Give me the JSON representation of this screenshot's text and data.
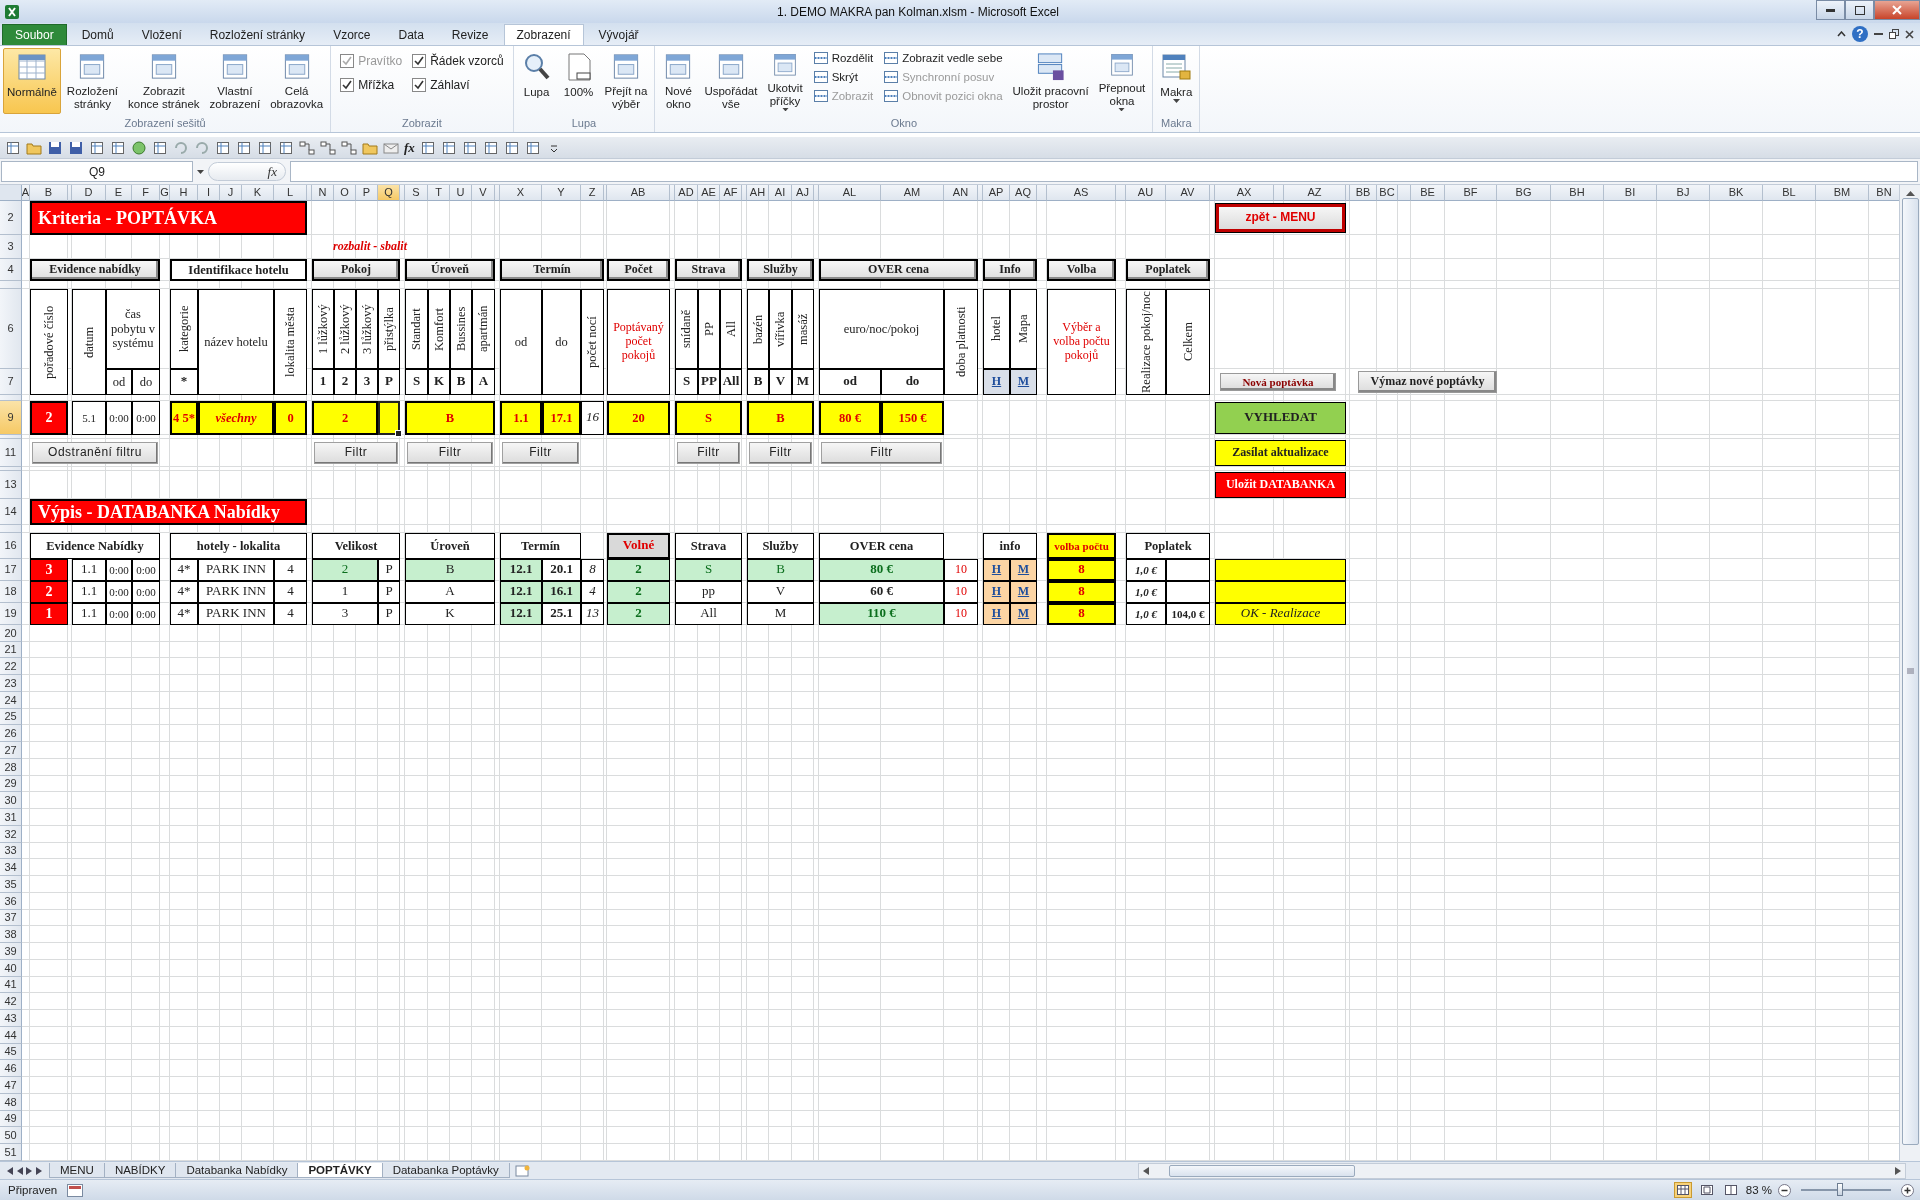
{
  "window": {
    "title": "1. DEMO MAKRA pan Kolman.xlsm  -  Microsoft Excel",
    "help": "?"
  },
  "ribbon_tabs": [
    {
      "label": "Soubor",
      "kind": "file",
      "selected": false
    },
    {
      "label": "Domů",
      "kind": "tab",
      "selected": false
    },
    {
      "label": "Vložení",
      "kind": "tab",
      "selected": false
    },
    {
      "label": "Rozložení stránky",
      "kind": "tab",
      "selected": false
    },
    {
      "label": "Vzorce",
      "kind": "tab",
      "selected": false
    },
    {
      "label": "Data",
      "kind": "tab",
      "selected": false
    },
    {
      "label": "Revize",
      "kind": "tab",
      "selected": false
    },
    {
      "label": "Zobrazení",
      "kind": "tab",
      "selected": true
    },
    {
      "label": "Vývojář",
      "kind": "tab",
      "selected": false
    }
  ],
  "ribbon_groups": [
    {
      "label": "Zobrazení sešitů",
      "items": [
        {
          "kind": "view",
          "label": "Normálně",
          "selected": true,
          "dropdown": false
        },
        {
          "kind": "view",
          "label": "Rozložení\nstránky",
          "selected": false,
          "dropdown": false
        },
        {
          "kind": "view",
          "label": "Zobrazit\nkonce stránek",
          "selected": false,
          "dropdown": false
        },
        {
          "kind": "large",
          "label": "Vlastní\nzobrazení",
          "dropdown": false
        },
        {
          "kind": "large",
          "label": "Celá\nobrazovka",
          "dropdown": false
        }
      ]
    },
    {
      "label": "Zobrazit",
      "items": [
        {
          "kind": "check",
          "label": "Pravítko",
          "checked": true,
          "disabled": true
        },
        {
          "kind": "check",
          "label": "Řádek vzorců",
          "checked": true,
          "disabled": false
        },
        {
          "kind": "check",
          "label": "Mřížka",
          "checked": true,
          "disabled": false
        },
        {
          "kind": "check",
          "label": "Záhlaví",
          "checked": true,
          "disabled": false
        }
      ]
    },
    {
      "label": "Lupa",
      "items": [
        {
          "kind": "large",
          "label": "Lupa",
          "dropdown": false
        },
        {
          "kind": "large",
          "label": "100%",
          "dropdown": false
        },
        {
          "kind": "large",
          "label": "Přejít na\nvýběr",
          "dropdown": false
        }
      ]
    },
    {
      "label": "Okno",
      "items": [
        {
          "kind": "large",
          "label": "Nové\nokno",
          "dropdown": false
        },
        {
          "kind": "large",
          "label": "Uspořádat\nvše",
          "dropdown": false
        },
        {
          "kind": "large",
          "label": "Ukotvit\npříčky",
          "dropdown": true
        },
        {
          "kind": "small",
          "label": "Rozdělit",
          "disabled": false
        },
        {
          "kind": "small",
          "label": "Skrýt",
          "disabled": false
        },
        {
          "kind": "small",
          "label": "Zobrazit",
          "disabled": true
        },
        {
          "kind": "small",
          "label": "Zobrazit vedle sebe",
          "disabled": false
        },
        {
          "kind": "small",
          "label": "Synchronní posuv",
          "disabled": true
        },
        {
          "kind": "small",
          "label": "Obnovit pozici okna",
          "disabled": true
        },
        {
          "kind": "large",
          "label": "Uložit pracovní\nprostor",
          "dropdown": false
        },
        {
          "kind": "large",
          "label": "Přepnout\nokna",
          "dropdown": true
        }
      ]
    },
    {
      "label": "Makra",
      "items": [
        {
          "kind": "large",
          "label": "Makra",
          "dropdown": true
        }
      ]
    }
  ],
  "quick_access": {
    "function_label": "fx"
  },
  "formula_bar": {
    "name_box": "Q9",
    "function_label": "fx"
  },
  "column_headers": [
    {
      "label": "A",
      "selected": false
    },
    {
      "label": "B",
      "selected": false
    },
    {
      "selected": false
    },
    {
      "label": "D",
      "selected": false
    },
    {
      "label": "E",
      "selected": false
    },
    {
      "label": "F",
      "selected": false
    },
    {
      "label": "G",
      "selected": false
    },
    {
      "label": "H",
      "selected": false
    },
    {
      "label": "I",
      "selected": false
    },
    {
      "label": "J",
      "selected": false
    },
    {
      "label": "K",
      "selected": false
    },
    {
      "label": "L",
      "selected": false
    },
    {
      "selected": false
    },
    {
      "label": "N",
      "selected": false
    },
    {
      "label": "O",
      "selected": false
    },
    {
      "label": "P",
      "selected": false
    },
    {
      "label": "Q",
      "selected": true
    },
    {
      "selected": false
    },
    {
      "label": "S",
      "selected": false
    },
    {
      "label": "T",
      "selected": false
    },
    {
      "label": "U",
      "selected": false
    },
    {
      "label": "V",
      "selected": false
    },
    {
      "selected": false
    },
    {
      "label": "X",
      "selected": false
    },
    {
      "label": "Y",
      "selected": false
    },
    {
      "label": "Z",
      "selected": false
    },
    {
      "selected": false
    },
    {
      "label": "AB",
      "selected": false
    },
    {
      "selected": false
    },
    {
      "label": "AD",
      "selected": false
    },
    {
      "label": "AE",
      "selected": false
    },
    {
      "label": "AF",
      "selected": false
    },
    {
      "selected": false
    },
    {
      "label": "AH",
      "selected": false
    },
    {
      "label": "AI",
      "selected": false
    },
    {
      "label": "AJ",
      "selected": false
    },
    {
      "selected": false
    },
    {
      "label": "AL",
      "selected": false
    },
    {
      "label": "AM",
      "selected": false
    },
    {
      "label": "AN",
      "selected": false
    },
    {
      "selected": false
    },
    {
      "label": "AP",
      "selected": false
    },
    {
      "label": "AQ",
      "selected": false
    },
    {
      "selected": false
    },
    {
      "label": "AS",
      "selected": false
    },
    {
      "selected": false
    },
    {
      "label": "AU",
      "selected": false
    },
    {
      "label": "AV",
      "selected": false
    },
    {
      "selected": false
    },
    {
      "label": "AX",
      "selected": false
    },
    {
      "selected": false
    },
    {
      "label": "AZ",
      "selected": false
    },
    {
      "selected": false
    },
    {
      "label": "BB",
      "selected": false
    },
    {
      "label": "BC",
      "selected": false
    },
    {
      "selected": false
    },
    {
      "label": "BE",
      "selected": false
    },
    {
      "label": "BF",
      "selected": false
    },
    {
      "label": "BG",
      "selected": false
    },
    {
      "label": "BH",
      "selected": false
    },
    {
      "label": "BI",
      "selected": false
    },
    {
      "label": "BJ",
      "selected": false
    },
    {
      "label": "BK",
      "selected": false
    },
    {
      "label": "BL",
      "selected": false
    },
    {
      "label": "BM",
      "selected": false
    },
    {
      "label": "BN",
      "selected": false
    }
  ],
  "row_headers": [
    {
      "label": "2",
      "selected": false
    },
    {
      "label": "3",
      "selected": false
    },
    {
      "label": "4",
      "selected": false
    },
    {
      "selected": false
    },
    {
      "label": "6",
      "selected": false
    },
    {
      "label": "7",
      "selected": false
    },
    {
      "selected": false
    },
    {
      "label": "9",
      "selected": true
    },
    {
      "selected": false
    },
    {
      "label": "11",
      "selected": false
    },
    {
      "selected": false
    },
    {
      "label": "13",
      "selected": false
    },
    {
      "label": "14",
      "selected": false
    },
    {
      "selected": false
    },
    {
      "label": "16",
      "selected": false
    },
    {
      "label": "17",
      "selected": false
    },
    {
      "label": "18",
      "selected": false
    },
    {
      "label": "19",
      "selected": false
    },
    {
      "label": "20",
      "selected": false
    },
    {
      "label": "21",
      "selected": false
    },
    {
      "label": "22",
      "selected": false
    },
    {
      "label": "23",
      "selected": false
    },
    {
      "label": "24",
      "selected": false
    },
    {
      "label": "25",
      "selected": false
    },
    {
      "label": "26",
      "selected": false
    },
    {
      "label": "27",
      "selected": false
    },
    {
      "label": "28",
      "selected": false
    },
    {
      "label": "29",
      "selected": false
    },
    {
      "label": "30",
      "selected": false
    },
    {
      "label": "31",
      "selected": false
    },
    {
      "label": "32",
      "selected": false
    },
    {
      "label": "33",
      "selected": false
    },
    {
      "label": "34",
      "selected": false
    },
    {
      "label": "35",
      "selected": false
    },
    {
      "label": "36",
      "selected": false
    },
    {
      "label": "37",
      "selected": false
    },
    {
      "label": "38",
      "selected": false
    },
    {
      "label": "39",
      "selected": false
    },
    {
      "label": "40",
      "selected": false
    },
    {
      "label": "41",
      "selected": false
    },
    {
      "label": "42",
      "selected": false
    },
    {
      "label": "43",
      "selected": false
    },
    {
      "label": "44",
      "selected": false
    },
    {
      "label": "45",
      "selected": false
    },
    {
      "label": "46",
      "selected": false
    },
    {
      "label": "47",
      "selected": false
    },
    {
      "label": "48",
      "selected": false
    },
    {
      "label": "49",
      "selected": false
    },
    {
      "label": "50",
      "selected": false
    },
    {
      "label": "51",
      "selected": false
    }
  ],
  "criteria": [
    {
      "text": "Kriteria - POPTÁVKA",
      "kind": "title"
    },
    {
      "text": "rozbalit - sbalit",
      "kind": "link"
    },
    {
      "text": "Evidence nabídky",
      "kind": "header-button"
    },
    {
      "text": "Identifikace hotelu",
      "kind": "header-box"
    },
    {
      "text": "Pokoj",
      "kind": "header-button"
    },
    {
      "text": "Úroveň",
      "kind": "header-button"
    },
    {
      "text": "Termín",
      "kind": "header-button"
    },
    {
      "text": "Počet",
      "kind": "header-button"
    },
    {
      "text": "Strava",
      "kind": "header-button"
    },
    {
      "text": "Služby",
      "kind": "header-button"
    },
    {
      "text": "OVER cena",
      "kind": "header-button"
    },
    {
      "text": "Info",
      "kind": "header-button"
    },
    {
      "text": "Volba",
      "kind": "header-button"
    },
    {
      "text": "Poplatek",
      "kind": "header-button"
    },
    {
      "text": "pořadové číslo",
      "kind": "vertical"
    },
    {
      "text": "datum",
      "kind": "vertical"
    },
    {
      "text": "čas pobytu v systému",
      "kind": "label"
    },
    {
      "text": "od",
      "kind": "label"
    },
    {
      "text": "do",
      "kind": "label"
    },
    {
      "text": "kategorie",
      "kind": "vertical"
    },
    {
      "text": "*",
      "kind": "key"
    },
    {
      "text": "název hotelu",
      "kind": "label"
    },
    {
      "text": "lokalita města",
      "kind": "vertical"
    },
    {
      "text": "1 lůžkový",
      "kind": "vertical"
    },
    {
      "text": "2 lůžkový",
      "kind": "vertical"
    },
    {
      "text": "3 lůžkový",
      "kind": "vertical"
    },
    {
      "text": "přistýlka",
      "kind": "vertical"
    },
    {
      "text": "1",
      "kind": "key"
    },
    {
      "text": "2",
      "kind": "key"
    },
    {
      "text": "3",
      "kind": "key"
    },
    {
      "text": "P",
      "kind": "key"
    },
    {
      "text": "Standart",
      "kind": "vertical"
    },
    {
      "text": "Komfort",
      "kind": "vertical"
    },
    {
      "text": "Bussines",
      "kind": "vertical"
    },
    {
      "text": "apartmán",
      "kind": "vertical"
    },
    {
      "text": "S",
      "kind": "key"
    },
    {
      "text": "K",
      "kind": "key"
    },
    {
      "text": "B",
      "kind": "key"
    },
    {
      "text": "A",
      "kind": "key"
    },
    {
      "text": "od",
      "kind": "label"
    },
    {
      "text": "do",
      "kind": "label"
    },
    {
      "text": "počet nocí",
      "kind": "vertical"
    },
    {
      "text": "Poptávaný počet pokojů",
      "kind": "label-red"
    },
    {
      "text": "snídaně",
      "kind": "vertical"
    },
    {
      "text": "PP",
      "kind": "vertical"
    },
    {
      "text": "All",
      "kind": "vertical"
    },
    {
      "text": "S",
      "kind": "key"
    },
    {
      "text": "PP",
      "kind": "key"
    },
    {
      "text": "All",
      "kind": "key"
    },
    {
      "text": "bazén",
      "kind": "vertical"
    },
    {
      "text": "vířivka",
      "kind": "vertical"
    },
    {
      "text": "masáž",
      "kind": "vertical"
    },
    {
      "text": "B",
      "kind": "key"
    },
    {
      "text": "V",
      "kind": "key"
    },
    {
      "text": "M",
      "kind": "key"
    },
    {
      "text": "euro/noc/pokoj",
      "kind": "label"
    },
    {
      "text": "od",
      "kind": "key"
    },
    {
      "text": "do",
      "kind": "key"
    },
    {
      "text": "doba platnosti",
      "kind": "vertical"
    },
    {
      "text": "hotel",
      "kind": "vertical"
    },
    {
      "text": "Mapa",
      "kind": "vertical"
    },
    {
      "text": "H",
      "kind": "link-button"
    },
    {
      "text": "M",
      "kind": "link-button"
    },
    {
      "text": "Výběr a volba počtu pokojů",
      "kind": "label-red"
    },
    {
      "text": "Realizace pokoj/noc",
      "kind": "vertical"
    },
    {
      "text": "Celkem",
      "kind": "vertical"
    },
    {
      "text": "2",
      "kind": "input-red"
    },
    {
      "text": "5.1",
      "kind": "value"
    },
    {
      "text": "0:00",
      "kind": "value"
    },
    {
      "text": "0:00",
      "kind": "value"
    },
    {
      "text": "4 5*",
      "kind": "input-yellow"
    },
    {
      "text": "všechny",
      "kind": "input-yellow-italic"
    },
    {
      "text": "0",
      "kind": "input-yellow"
    },
    {
      "text": "2",
      "kind": "input-yellow"
    },
    {
      "kind": "active"
    },
    {
      "text": "B",
      "kind": "input-yellow"
    },
    {
      "text": "1.1",
      "kind": "input-yellow"
    },
    {
      "text": "17.1",
      "kind": "input-yellow"
    },
    {
      "text": "16",
      "kind": "italic-value"
    },
    {
      "text": "20",
      "kind": "input-yellow"
    },
    {
      "text": "S",
      "kind": "input-yellow"
    },
    {
      "text": "B",
      "kind": "input-yellow"
    },
    {
      "text": "80 €",
      "kind": "input-yellow"
    },
    {
      "text": "150 €",
      "kind": "input-yellow"
    },
    {
      "text": "Odstranění filtru",
      "kind": "filter-button"
    },
    {
      "text": "Filtr",
      "kind": "filter-button"
    },
    {
      "text": "Filtr",
      "kind": "filter-button"
    },
    {
      "text": "Filtr",
      "kind": "filter-button"
    },
    {
      "text": "Filtr",
      "kind": "filter-button"
    },
    {
      "text": "Filtr",
      "kind": "filter-button"
    },
    {
      "text": "Filtr",
      "kind": "filter-button"
    }
  ],
  "actions": [
    {
      "text": "zpět -  MENU",
      "kind": "menu-button"
    },
    {
      "text": "Nová poptávka",
      "kind": "small-button"
    },
    {
      "text": "Výmaz nové poptávky",
      "kind": "wide-button"
    },
    {
      "text": "VYHLEDAT",
      "kind": "green"
    },
    {
      "text": "Zasílat aktualizace",
      "kind": "yellow"
    },
    {
      "text": "Uložit DATABANKA",
      "kind": "red"
    }
  ],
  "databank": {
    "title": "Výpis - DATABANKA Nabídky",
    "headers": [
      {
        "text": "Evidence Nabídky",
        "kind": "header"
      },
      {
        "text": "hotely - lokalita",
        "kind": "header"
      },
      {
        "text": "Velikost",
        "kind": "header"
      },
      {
        "text": "Úroveň",
        "kind": "header"
      },
      {
        "text": "Termín",
        "kind": "header"
      },
      {
        "text": "Volné",
        "kind": "free-header"
      },
      {
        "text": "Strava",
        "kind": "header"
      },
      {
        "text": "Služby",
        "kind": "header"
      },
      {
        "text": "OVER cena",
        "kind": "header"
      },
      {
        "text": "info",
        "kind": "header"
      },
      {
        "text": "volba počtu",
        "kind": "count-header"
      },
      {
        "text": "Poplatek",
        "kind": "header"
      }
    ],
    "rows": [
      {
        "id": "3",
        "date": "1.1",
        "time_from": "0:00",
        "time_to": "0:00",
        "category": "4*",
        "hotel": "PARK INN",
        "locality": "4",
        "size": {
          "text": "2",
          "match": true
        },
        "extra_bed": "P",
        "level": {
          "text": "B",
          "match": true
        },
        "term_from": {
          "text": "12.1",
          "match": true
        },
        "term_to": {
          "text": "20.1",
          "match": false
        },
        "nights": "8",
        "free": {
          "text": "2",
          "match": true
        },
        "board": {
          "text": "S",
          "match": true
        },
        "services": {
          "text": "B",
          "match": true
        },
        "price": {
          "text": "80 €",
          "match": true
        },
        "validity": "10",
        "info_hotel": "H",
        "info_map": "M",
        "count": "8",
        "fee": "1,0 €"
      },
      {
        "id": "2",
        "date": "1.1",
        "time_from": "0:00",
        "time_to": "0:00",
        "category": "4*",
        "hotel": "PARK INN",
        "locality": "4",
        "size": {
          "text": "1",
          "match": false
        },
        "extra_bed": "P",
        "level": {
          "text": "A",
          "match": false
        },
        "term_from": {
          "text": "12.1",
          "match": true
        },
        "term_to": {
          "text": "16.1",
          "match": true
        },
        "nights": "4",
        "free": {
          "text": "2",
          "match": true
        },
        "board": {
          "text": "pp",
          "match": false
        },
        "services": {
          "text": "V",
          "match": false
        },
        "price": {
          "text": "60 €",
          "match": false
        },
        "validity": "10",
        "info_hotel": "H",
        "info_map": "M",
        "count": "8",
        "fee": "1,0 €"
      },
      {
        "id": "1",
        "date": "1.1",
        "time_from": "0:00",
        "time_to": "0:00",
        "category": "4*",
        "hotel": "PARK INN",
        "locality": "4",
        "size": {
          "text": "3",
          "match": false
        },
        "extra_bed": "P",
        "level": {
          "text": "K",
          "match": false
        },
        "term_from": {
          "text": "12.1",
          "match": true
        },
        "term_to": {
          "text": "25.1",
          "match": false
        },
        "nights": "13",
        "free": {
          "text": "2",
          "match": true
        },
        "board": {
          "text": "All",
          "match": false
        },
        "services": {
          "text": "M",
          "match": false
        },
        "price": {
          "text": "110 €",
          "match": true
        },
        "validity": "10",
        "info_hotel": "H",
        "info_map": "M",
        "count": "8",
        "fee": "1,0 €",
        "total": "104,0 €",
        "status": "OK - Realizace"
      }
    ]
  },
  "sheet_tabs": [
    {
      "label": "MENU",
      "selected": false
    },
    {
      "label": "NABÍDKY",
      "selected": false
    },
    {
      "label": "Databanka Nabídky",
      "selected": false
    },
    {
      "label": "POPTÁVKY",
      "selected": true
    },
    {
      "label": "Databanka Poptávky",
      "selected": false
    }
  ],
  "status_bar": {
    "text": "Připraven",
    "views": [
      {
        "selected": true
      },
      {
        "selected": false
      },
      {
        "selected": false
      }
    ],
    "zoom": "83 %",
    "zoom_slider": {
      "level": 0.43
    }
  }
}
